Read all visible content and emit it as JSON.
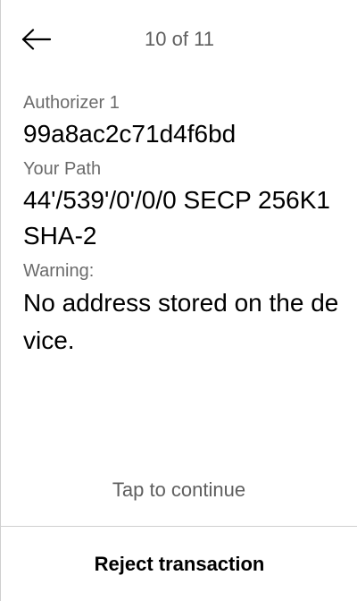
{
  "header": {
    "step_indicator": "10 of 11",
    "back_icon": "arrow-left-icon"
  },
  "details": {
    "authorizer_label": "Authorizer 1",
    "authorizer_value": "99a8ac2c71d4f6bd",
    "path_label": "Your Path",
    "path_value": "44'/539'/0'/0/0   SECP 256K1 SHA-2",
    "warning_label": "Warning:",
    "warning_value": "No address stored on the device."
  },
  "footer": {
    "tap_hint": "Tap to continue",
    "reject_label": "Reject transaction"
  }
}
